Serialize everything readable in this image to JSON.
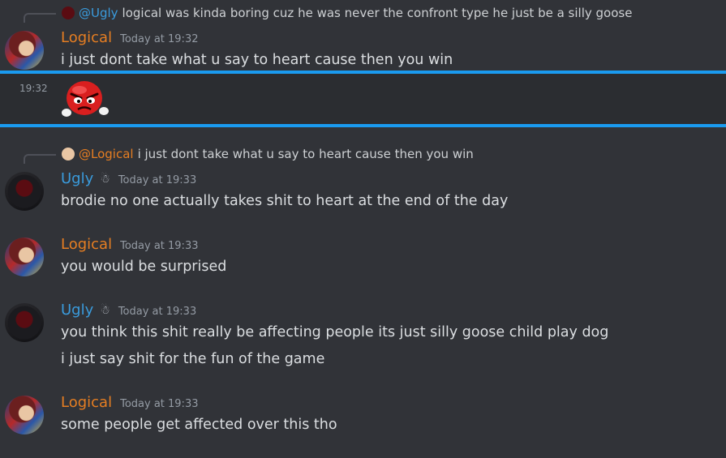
{
  "messages": [
    {
      "reply": {
        "mention": "@Ugly",
        "text": "logical was kinda boring cuz he was never the confront type he just be a silly goose"
      },
      "author": "Logical",
      "timestamp": "Today at 19:32",
      "lines": [
        "i just dont take what u say to heart cause then you win"
      ]
    },
    {
      "side_time": "19:32",
      "emoji": "angry-red-candy-emoji"
    },
    {
      "reply": {
        "mention": "@Logical",
        "text": "i just dont take what u say to heart cause then you win"
      },
      "author": "Ugly",
      "timestamp": "Today at 19:33",
      "lines": [
        "brodie no one actually takes shit to heart at the end of the day"
      ]
    },
    {
      "author": "Logical",
      "timestamp": "Today at 19:33",
      "lines": [
        "you would be surprised"
      ]
    },
    {
      "author": "Ugly",
      "timestamp": "Today at 19:33",
      "lines": [
        "you think this shit really be affecting people its just silly goose child play dog",
        "i just say shit for the fun of the game"
      ]
    },
    {
      "author": "Logical",
      "timestamp": "Today at 19:33",
      "lines": [
        "some people get affected over this tho"
      ]
    }
  ],
  "colors": {
    "background": "#313338",
    "logical_name": "#e67e22",
    "ugly_name": "#3a9bdc",
    "mention": "#3a9bdc",
    "mention_logical": "#e67e22",
    "highlight_border": "#1a9bf0",
    "timestamp": "#949ba4"
  }
}
